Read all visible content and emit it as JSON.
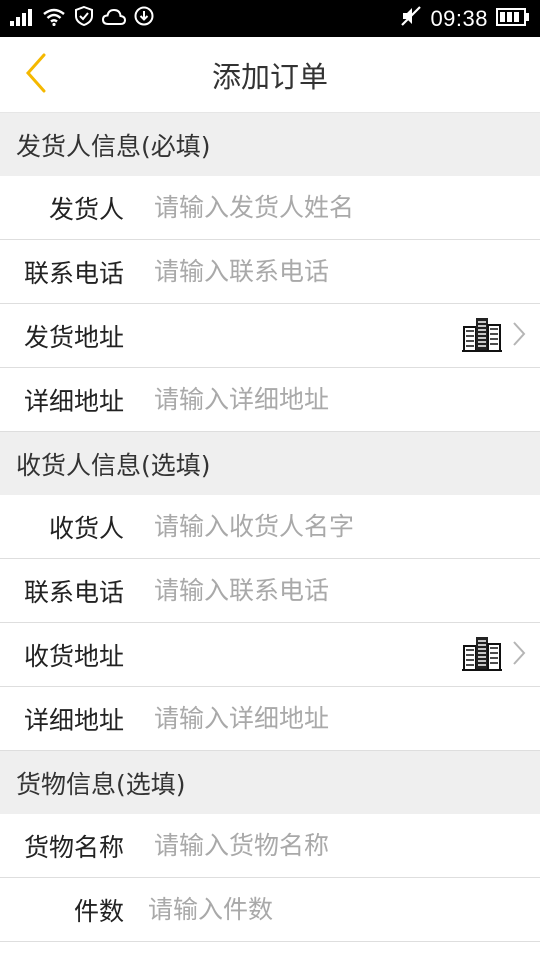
{
  "status_bar": {
    "time": "09:38",
    "icons": [
      "signal-icon",
      "wifi-icon",
      "sync-shield-icon",
      "cloud-icon",
      "download-icon",
      "mute-icon",
      "battery-icon"
    ]
  },
  "nav": {
    "title": "添加订单",
    "back_icon": "chevron-left-icon"
  },
  "colors": {
    "accent": "#f5b800",
    "section_bg": "#efefef",
    "placeholder": "#a9a9a9"
  },
  "sender": {
    "header": "发货人信息(必填)",
    "name_label": "发货人",
    "name_placeholder": "请输入发货人姓名",
    "phone_label": "联系电话",
    "phone_placeholder": "请输入联系电话",
    "address_label": "发货地址",
    "detail_label": "详细地址",
    "detail_placeholder": "请输入详细地址"
  },
  "receiver": {
    "header": "收货人信息(选填)",
    "name_label": "收货人",
    "name_placeholder": "请输入收货人名字",
    "phone_label": "联系电话",
    "phone_placeholder": "请输入联系电话",
    "address_label": "收货地址",
    "detail_label": "详细地址",
    "detail_placeholder": "请输入详细地址"
  },
  "goods": {
    "header": "货物信息(选填)",
    "name_label": "货物名称",
    "name_placeholder": "请输入货物名称",
    "count_label": "件数",
    "count_placeholder": "请输入件数"
  }
}
